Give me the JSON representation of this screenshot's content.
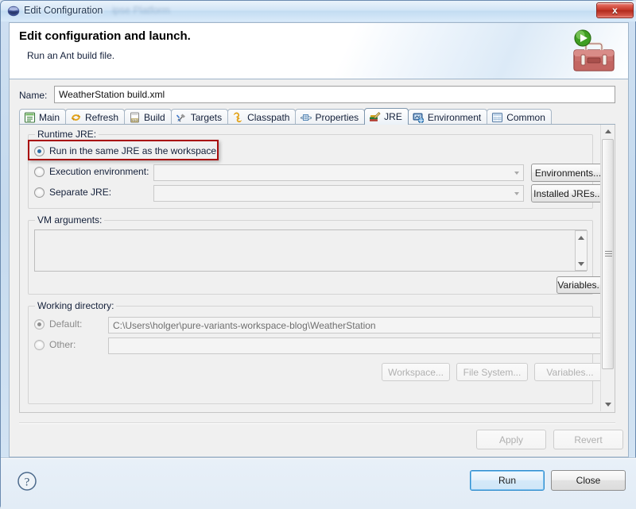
{
  "window": {
    "title": "Edit Configuration",
    "ghost_title": "ipse Platform",
    "close_label": "x",
    "icon": "eclipse-icon"
  },
  "banner": {
    "title": "Edit configuration and launch.",
    "subtitle": "Run an Ant build file.",
    "icon": "ant-toolbox-icon"
  },
  "name_field": {
    "label": "Name:",
    "value": "WeatherStation build.xml",
    "placeholder": ""
  },
  "tabs": [
    {
      "label": "Main",
      "icon": "main-tab-icon",
      "active": false
    },
    {
      "label": "Refresh",
      "icon": "refresh-tab-icon",
      "active": false
    },
    {
      "label": "Build",
      "icon": "build-tab-icon",
      "active": false
    },
    {
      "label": "Targets",
      "icon": "targets-tab-icon",
      "active": false
    },
    {
      "label": "Classpath",
      "icon": "classpath-tab-icon",
      "active": false
    },
    {
      "label": "Properties",
      "icon": "properties-tab-icon",
      "active": false
    },
    {
      "label": "JRE",
      "icon": "jre-tab-icon",
      "active": true
    },
    {
      "label": "Environment",
      "icon": "environment-tab-icon",
      "active": false
    },
    {
      "label": "Common",
      "icon": "common-tab-icon",
      "active": false
    }
  ],
  "runtime_jre": {
    "group_label": "Runtime JRE:",
    "options": [
      {
        "label": "Run in the same JRE as the workspace",
        "selected": true,
        "highlighted": true
      },
      {
        "label": "Execution environment:",
        "selected": false,
        "highlighted": false
      },
      {
        "label": "Separate JRE:",
        "selected": false,
        "highlighted": false
      }
    ],
    "execution_environment_value": "",
    "separate_jre_value": "",
    "environments_button": "Environments...",
    "installed_jres_button": "Installed JREs..."
  },
  "vm_arguments": {
    "group_label": "VM arguments:",
    "value": "",
    "variables_button": "Variables..."
  },
  "working_directory": {
    "group_label": "Working directory:",
    "options": [
      {
        "label": "Default:",
        "selected": true,
        "enabled": false
      },
      {
        "label": "Other:",
        "selected": false,
        "enabled": false
      }
    ],
    "default_value": "C:\\Users\\holger\\pure-variants-workspace-blog\\WeatherStation",
    "other_value": "",
    "workspace_button": "Workspace...",
    "file_system_button": "File System...",
    "variables_button": "Variables..."
  },
  "action_buttons": {
    "apply": "Apply",
    "revert": "Revert"
  },
  "footer": {
    "help_icon": "help-question-icon",
    "run_button": "Run",
    "close_button": "Close"
  },
  "colors": {
    "highlight_red": "#a90d0d",
    "default_button_blue": "#2e8ccd",
    "radio_selected_blue": "#2b6ca3",
    "close_button_red": "#c23224"
  }
}
